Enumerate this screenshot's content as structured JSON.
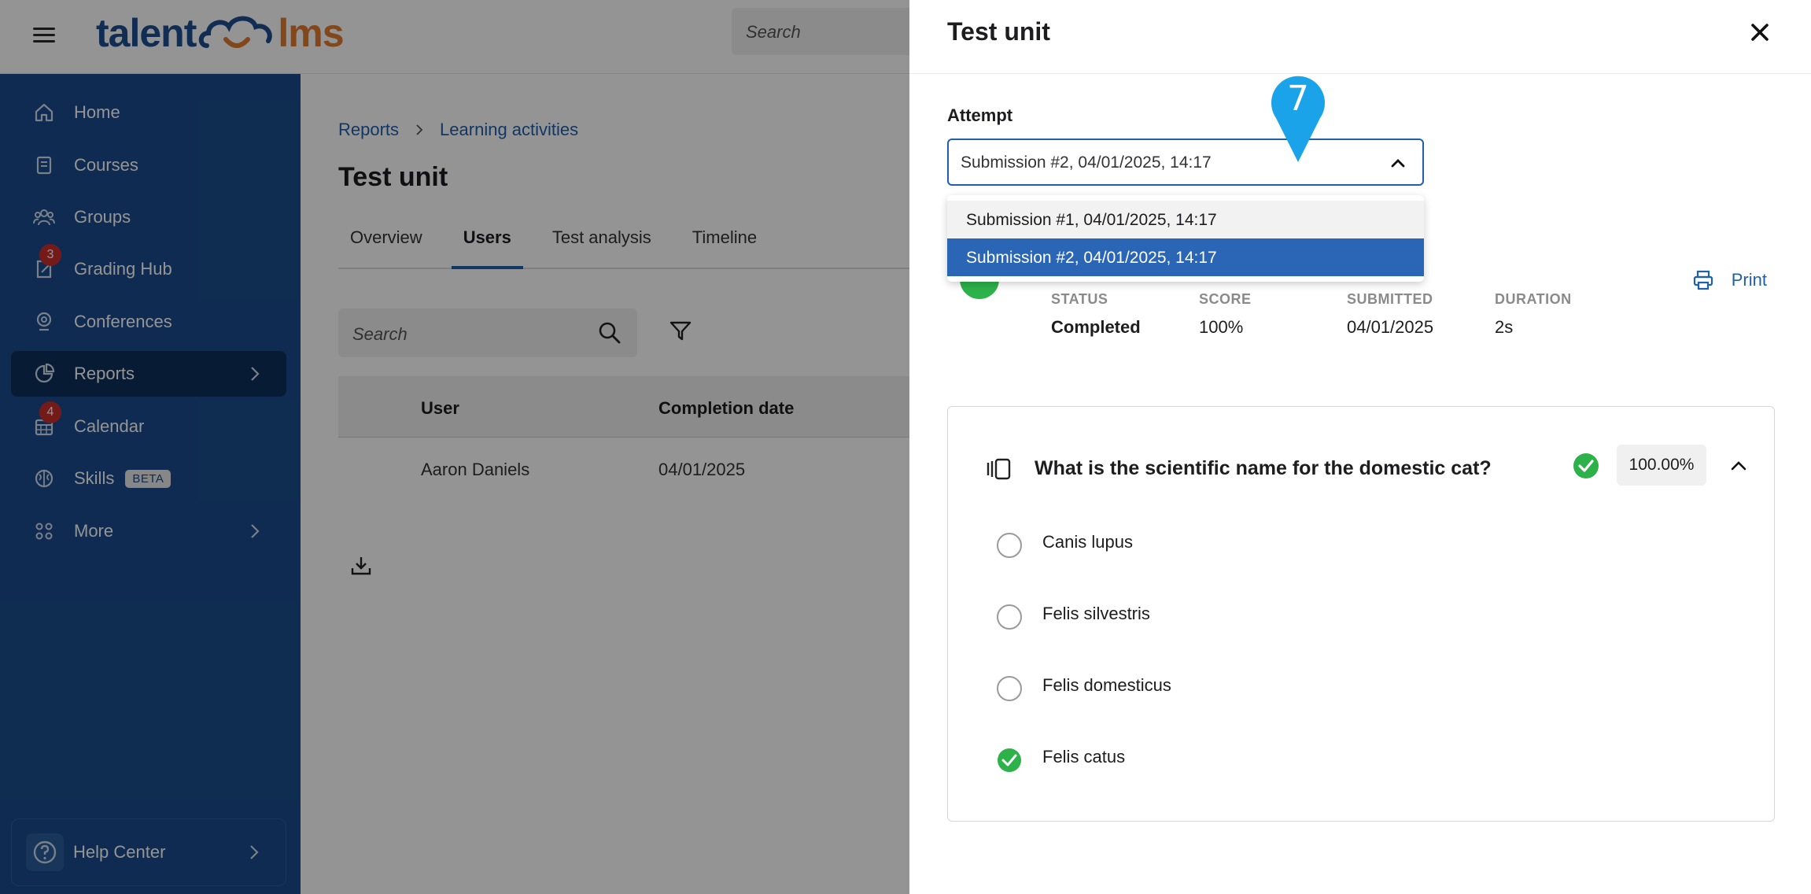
{
  "topbar": {
    "logo_left": "talent",
    "logo_right": "lms",
    "search_placeholder": "Search"
  },
  "sidebar": {
    "items": [
      {
        "label": "Home",
        "icon": "home-icon"
      },
      {
        "label": "Courses",
        "icon": "book-icon"
      },
      {
        "label": "Groups",
        "icon": "users-icon"
      },
      {
        "label": "Grading Hub",
        "icon": "grading-icon",
        "badge": "3"
      },
      {
        "label": "Conferences",
        "icon": "conference-icon"
      },
      {
        "label": "Reports",
        "icon": "pie-chart-icon",
        "active": true
      },
      {
        "label": "Calendar",
        "icon": "calendar-icon",
        "badge": "4"
      },
      {
        "label": "Skills",
        "icon": "brain-icon",
        "tag": "BETA"
      },
      {
        "label": "More",
        "icon": "grid-icon"
      }
    ],
    "help_label": "Help Center"
  },
  "main": {
    "breadcrumb": [
      "Reports",
      "Learning activities"
    ],
    "title": "Test unit",
    "tabs": [
      "Overview",
      "Users",
      "Test analysis",
      "Timeline"
    ],
    "active_tab": "Users",
    "search_placeholder": "Search",
    "table": {
      "columns": [
        "User",
        "Completion date"
      ],
      "rows": [
        [
          "Aaron Daniels",
          "04/01/2025"
        ]
      ]
    }
  },
  "panel": {
    "title": "Test unit",
    "attempt_label": "Attempt",
    "selected_attempt": "Submission #2, 04/01/2025, 14:17",
    "attempt_options": [
      "Submission #1, 04/01/2025, 14:17",
      "Submission #2, 04/01/2025, 14:17"
    ],
    "step_marker": "7",
    "print_label": "Print",
    "stats": [
      {
        "label": "STATUS",
        "value": "Completed"
      },
      {
        "label": "SCORE",
        "value": "100%"
      },
      {
        "label": "SUBMITTED",
        "value": "04/01/2025"
      },
      {
        "label": "DURATION",
        "value": "2s"
      }
    ],
    "question": {
      "text": "What is the scientific name for the domestic cat?",
      "score": "100.00%",
      "options": [
        "Canis lupus",
        "Felis silvestris",
        "Felis domesticus",
        "Felis catus"
      ],
      "selected_option": "Felis catus"
    }
  },
  "colors": {
    "sidebar_bg": "#1a4b8c",
    "sidebar_active": "#0f2f5c",
    "accent_blue": "#1f5fae",
    "success_green": "#2db24a",
    "badge_red": "#c8302e",
    "pin_blue": "#1aa3e8"
  }
}
